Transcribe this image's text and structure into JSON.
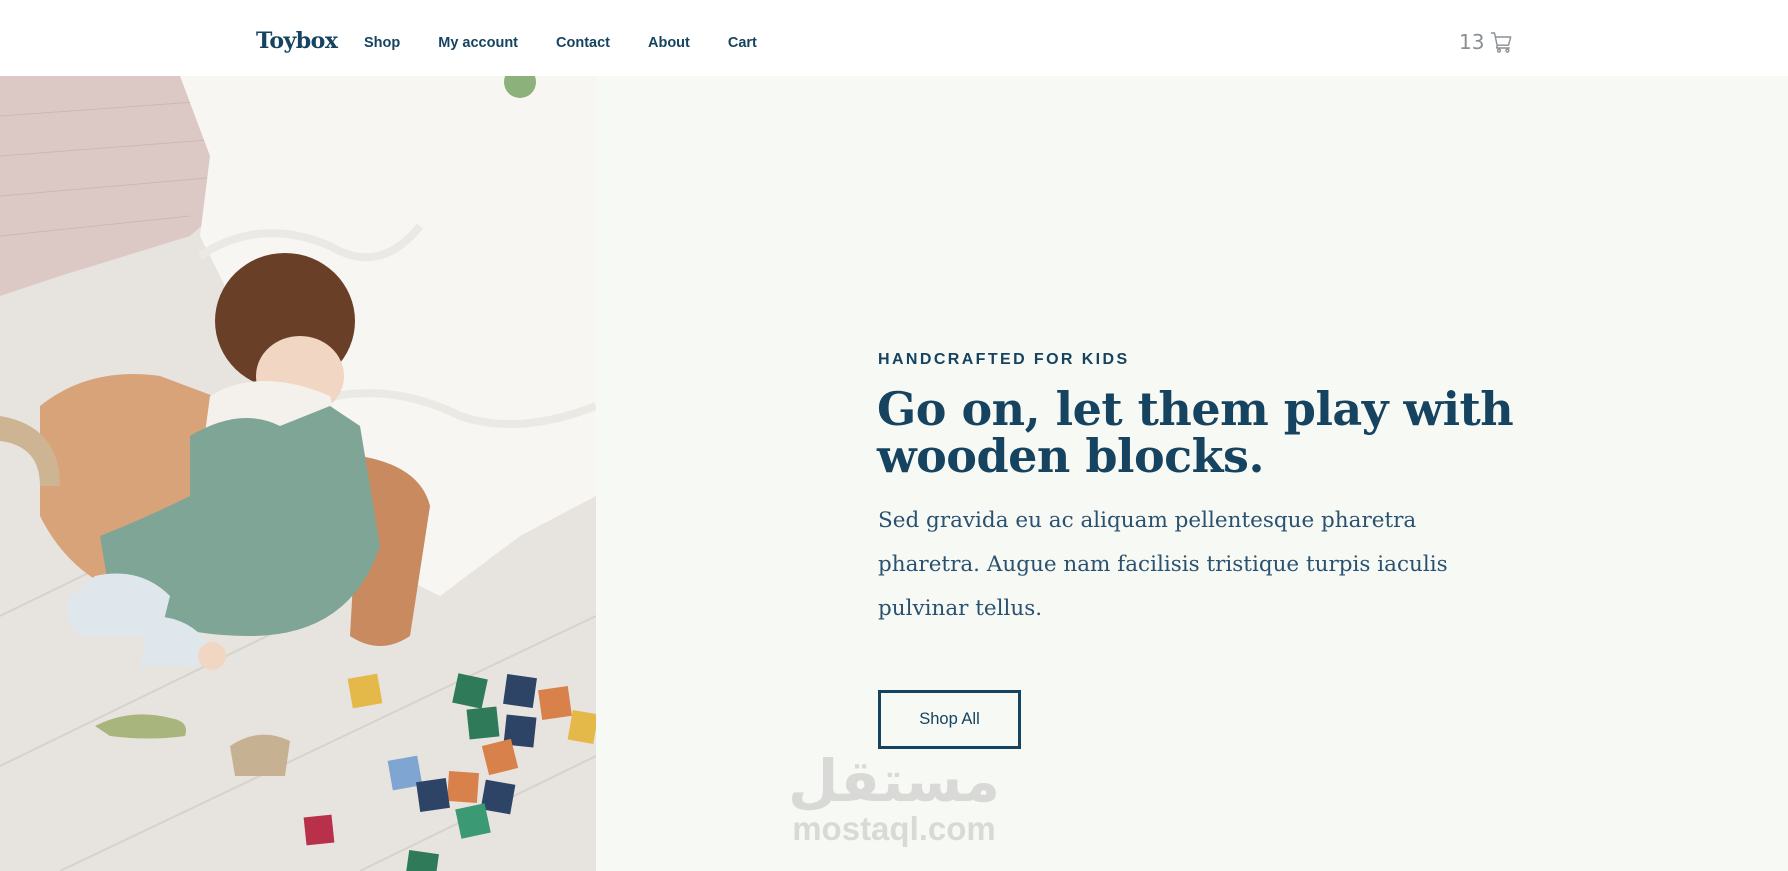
{
  "header": {
    "logo": "Toybox",
    "nav": [
      {
        "label": "Shop"
      },
      {
        "label": "My account"
      },
      {
        "label": "Contact"
      },
      {
        "label": "About"
      },
      {
        "label": "Cart"
      }
    ],
    "cart_count": "13",
    "cart_icon": "cart-icon"
  },
  "hero": {
    "image": "child-playing-with-wooden-blocks",
    "eyebrow": "HANDCRAFTED FOR KIDS",
    "headline": "Go on, let them play with wooden blocks.",
    "body": "Sed gravida eu ac aliquam pellentesque pharetra pharetra. Augue nam facilisis tristique turpis iaculis pulvinar tellus.",
    "button_label": "Shop All"
  },
  "watermark": {
    "arabic": "مستقل",
    "latin": "mostaql.com"
  },
  "colors": {
    "primary": "#154360",
    "panel_bg": "#f7f9f4",
    "cart_count": "#8a8f93"
  }
}
